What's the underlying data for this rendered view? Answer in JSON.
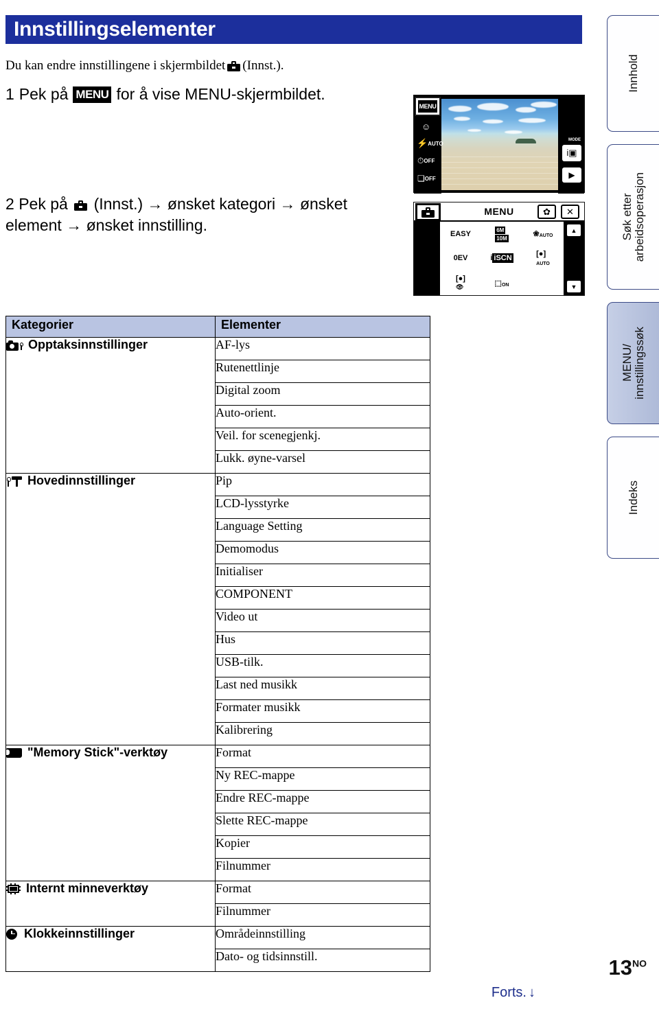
{
  "title": "Innstillingselementer",
  "intro": {
    "before": "Du kan endre innstillingene i skjermbildet",
    "icon": "toolbox-icon",
    "after": "(Innst.)."
  },
  "steps": [
    {
      "num": "1",
      "before": "Pek på",
      "badge": "MENU",
      "after": "for å vise MENU-skjermbildet."
    },
    {
      "num": "2",
      "before": "Pek på",
      "icon": "toolbox-icon",
      "after": "(Innst.) → ønsket kategori → ønsket element → ønsket innstilling."
    }
  ],
  "camera": {
    "live_view": {
      "menu_button": "MENU",
      "left_icons": [
        "smile-icon",
        "flash-auto-icon",
        "self-timer-off-icon",
        "burst-off-icon"
      ],
      "flash_label": "AUTO",
      "timer_label": "OFF",
      "burst_label": "OFF",
      "mode_label": "MODE",
      "mode_icon": "i-camera-icon",
      "play_icon": "play-icon"
    },
    "menu_screen": {
      "toolbox_button": "toolbox-icon",
      "title": "MENU",
      "gear_button": "gear-icon",
      "close_button": "close-icon",
      "items": [
        "EASY",
        "10M",
        "AUTO",
        "0EV",
        "iSCN",
        "AUTO",
        "redeye",
        "ON"
      ],
      "scroll_up": "chevron-up-icon",
      "scroll_down": "chevron-down-icon"
    }
  },
  "side_tabs": [
    {
      "label": "Innhold",
      "active": false
    },
    {
      "label": "Søk etter\narbeidsoperasjon",
      "active": false
    },
    {
      "label": "MENU/\ninnstillingssøk",
      "active": true
    },
    {
      "label": "Indeks",
      "active": false
    }
  ],
  "table": {
    "headers": {
      "categories": "Kategorier",
      "elements": "Elementer"
    },
    "groups": [
      {
        "icon": "camera-settings-icon",
        "category": "Opptaksinnstillinger",
        "items": [
          "AF-lys",
          "Rutenettlinje",
          "Digital zoom",
          "Auto-orient.",
          "Veil. for scenegjenkj.",
          "Lukk. øyne-varsel"
        ]
      },
      {
        "icon": "main-settings-icon",
        "category": "Hovedinnstillinger",
        "items": [
          "Pip",
          "LCD-lysstyrke",
          "Language Setting",
          "Demomodus",
          "Initialiser",
          "COMPONENT",
          "Video ut",
          "Hus",
          "USB-tilk.",
          "Last ned musikk",
          "Formater musikk",
          "Kalibrering"
        ]
      },
      {
        "icon": "memory-stick-icon",
        "category": "\"Memory Stick\"-verktøy",
        "items": [
          "Format",
          "Ny REC-mappe",
          "Endre REC-mappe",
          "Slette REC-mappe",
          "Kopier",
          "Filnummer"
        ]
      },
      {
        "icon": "internal-memory-icon",
        "category": "Internt minneverktøy",
        "items": [
          "Format",
          "Filnummer"
        ]
      },
      {
        "icon": "clock-icon",
        "category": "Klokkeinnstillinger",
        "items": [
          "Områdeinnstilling",
          "Dato- og tidsinnstill."
        ]
      }
    ]
  },
  "footer": {
    "page": "13",
    "page_suffix": "NO",
    "continued": "Forts.",
    "continued_arrow": "↓"
  },
  "colors": {
    "title_bar": "#1c2f9c",
    "table_header": "#b9c4e2",
    "active_tab": "#b8c2de",
    "link_blue": "#1e2f8c"
  }
}
